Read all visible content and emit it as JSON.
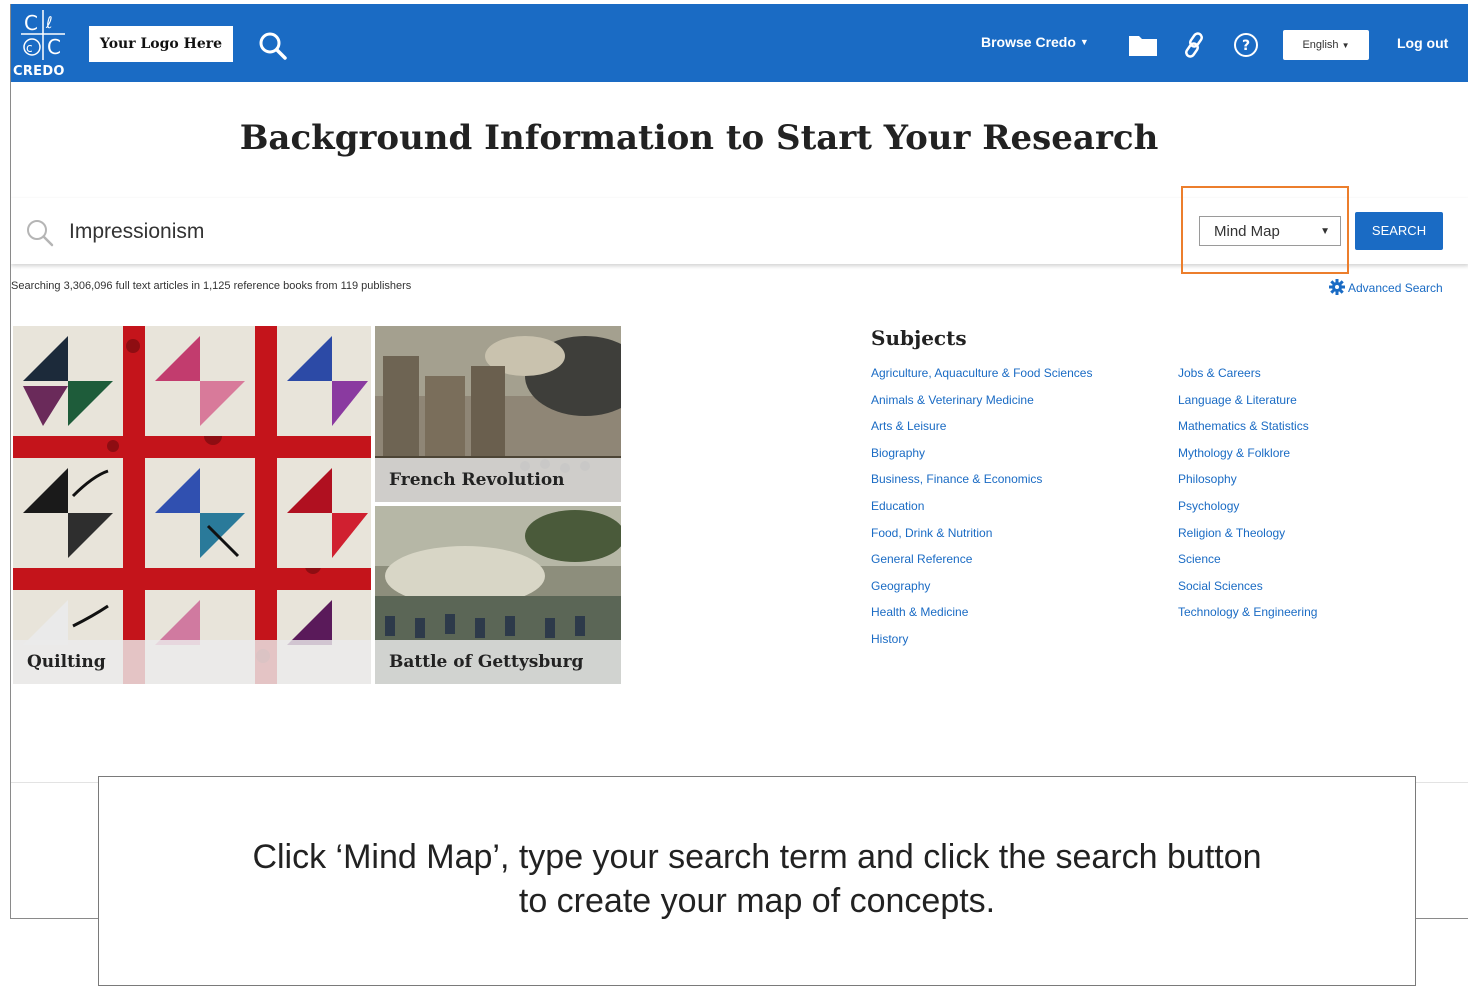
{
  "header": {
    "brand": "CREDO",
    "logo_placeholder": "Your Logo Here",
    "browse_label": "Browse Credo",
    "language": "English",
    "logout_label": "Log out",
    "accent": "#1a6bc4"
  },
  "page": {
    "title": "Background Information to Start Your Research"
  },
  "search": {
    "value": "Impressionism",
    "mode": "Mind Map",
    "button_label": "SEARCH",
    "count_text": "Searching 3,306,096 full text articles in 1,125 reference books from 119 publishers",
    "advanced_label": "Advanced Search",
    "highlight_color": "#ec7e2c"
  },
  "tiles": [
    {
      "label": "Quilting"
    },
    {
      "label": "French Revolution"
    },
    {
      "label": "Battle of Gettysburg"
    }
  ],
  "subjects": {
    "title": "Subjects",
    "col1": [
      "Agriculture, Aquaculture & Food Sciences",
      "Animals & Veterinary Medicine",
      "Arts & Leisure",
      "Biography",
      "Business, Finance & Economics",
      "Education",
      "Food, Drink & Nutrition",
      "General Reference",
      "Geography",
      "Health & Medicine",
      "History"
    ],
    "col2": [
      "Jobs & Careers",
      "Language & Literature",
      "Mathematics & Statistics",
      "Mythology & Folklore",
      "Philosophy",
      "Psychology",
      "Religion & Theology",
      "Science",
      "Social Sciences",
      "Technology & Engineering"
    ]
  },
  "caption": {
    "line1": "Click ‘Mind Map’, type your search term and click the search button",
    "line2": "to create your map of concepts."
  }
}
